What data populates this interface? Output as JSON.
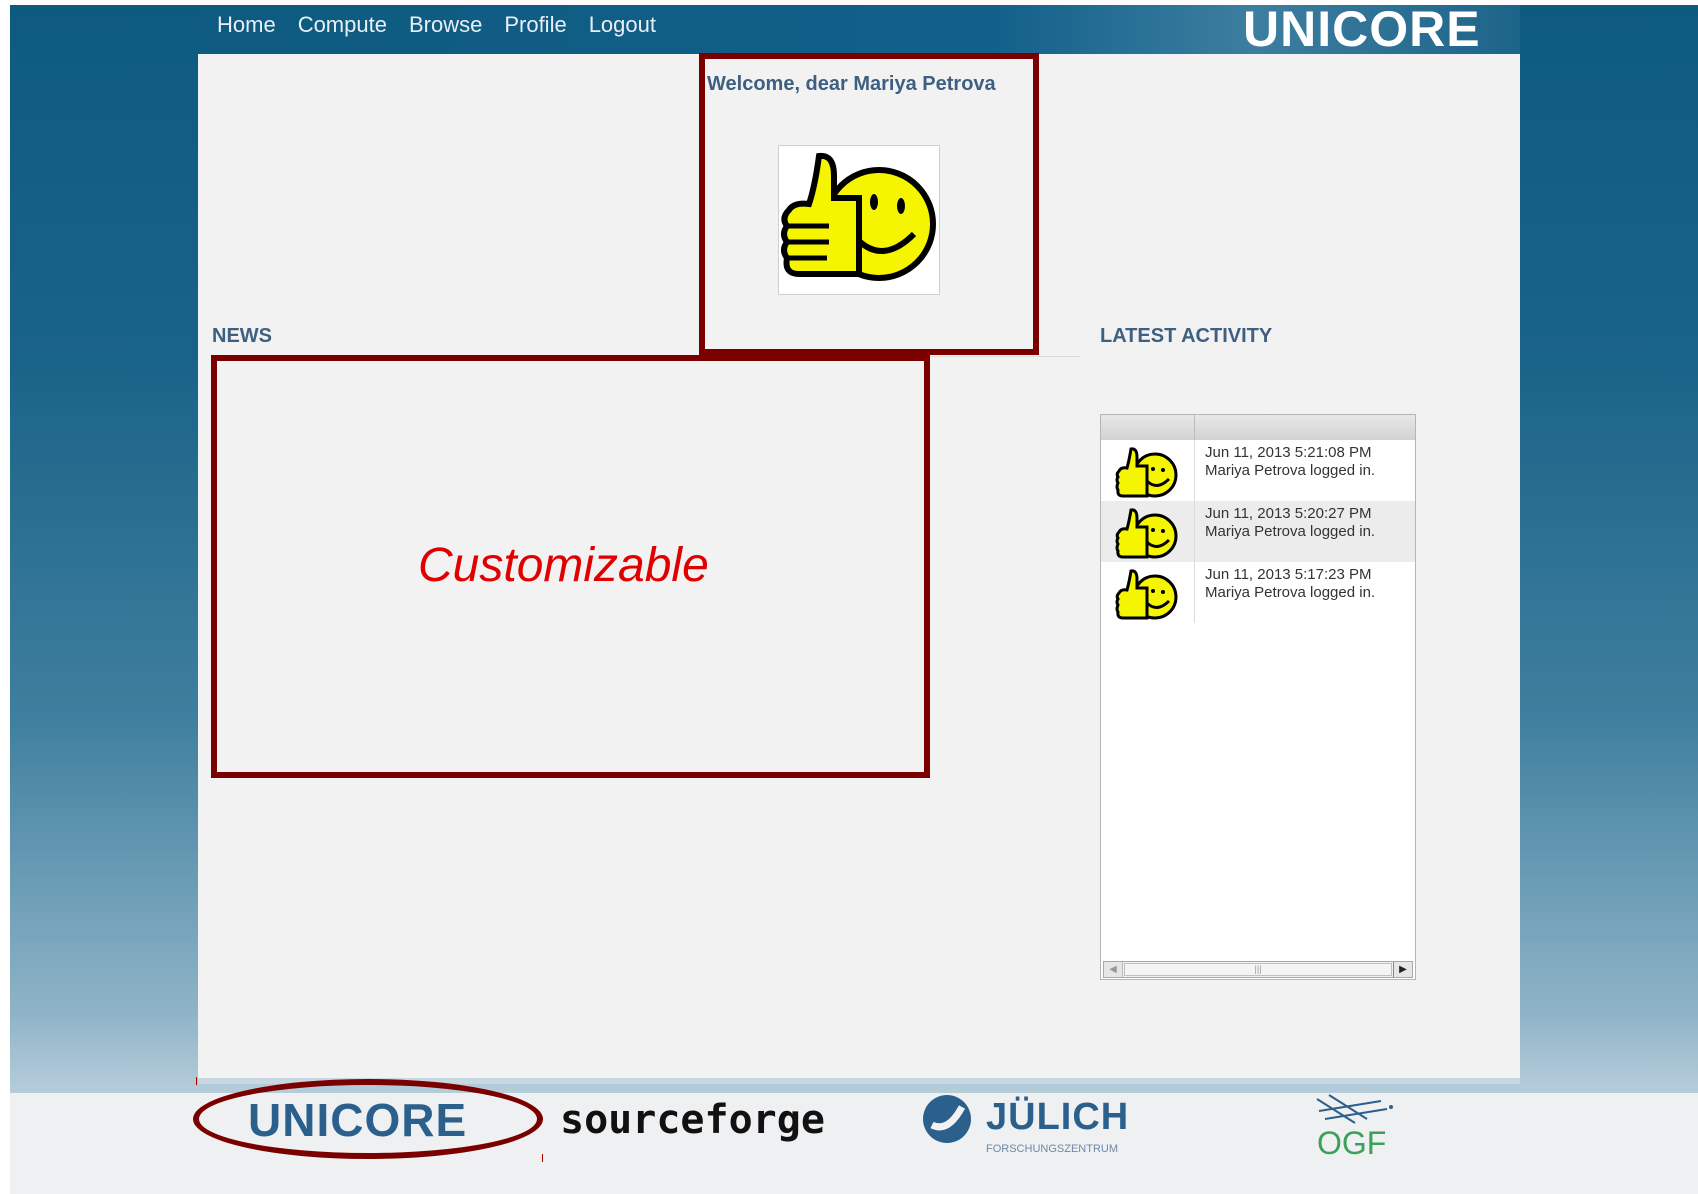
{
  "nav": {
    "items": [
      {
        "label": "Home"
      },
      {
        "label": "Compute"
      },
      {
        "label": "Browse"
      },
      {
        "label": "Profile"
      },
      {
        "label": "Logout"
      }
    ]
  },
  "header": {
    "logo": "UNICORE"
  },
  "welcome": {
    "text": "Welcome, dear Mariya Petrova",
    "avatar_icon": "thumbs-up-smiley"
  },
  "news": {
    "title": "NEWS",
    "placeholder": "Customizable"
  },
  "activity": {
    "title": "LATEST ACTIVITY",
    "rows": [
      {
        "timestamp": "Jun 11, 2013 5:21:08 PM",
        "message": "Mariya Petrova logged in.",
        "icon": "thumbs-up-smiley"
      },
      {
        "timestamp": "Jun 11, 2013 5:20:27 PM",
        "message": "Mariya Petrova logged in.",
        "icon": "thumbs-up-smiley"
      },
      {
        "timestamp": "Jun 11, 2013 5:17:23 PM",
        "message": "Mariya Petrova logged in.",
        "icon": "thumbs-up-smiley"
      }
    ]
  },
  "footer": {
    "unicore": "UNICORE",
    "sourceforge": "sourceforge",
    "juelich": "JÜLICH",
    "juelich_sub": "FORSCHUNGSZENTRUM",
    "ogf": "OGF"
  },
  "colors": {
    "accent": "#3f5f80",
    "highlight": "#7a0000",
    "custom_text": "#e00000"
  }
}
